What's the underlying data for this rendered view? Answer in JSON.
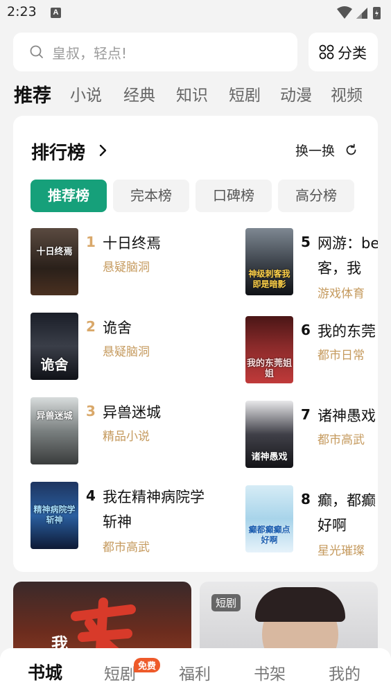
{
  "status": {
    "time": "2:23",
    "app_icon_letter": "A"
  },
  "search": {
    "placeholder": "皇叔，轻点!"
  },
  "category": {
    "label": "分类"
  },
  "tabs": [
    "推荐",
    "小说",
    "经典",
    "知识",
    "短剧",
    "动漫",
    "视频"
  ],
  "ranking": {
    "title": "排行榜",
    "refresh_label": "换一换",
    "subtabs": [
      "推荐榜",
      "完本榜",
      "口碑榜",
      "高分榜"
    ],
    "books": [
      {
        "rank": "1",
        "name": "十日终焉",
        "genre": "悬疑脑洞",
        "cover_text": "十日终焉"
      },
      {
        "rank": "2",
        "name": "诡舍",
        "genre": "悬疑脑洞",
        "cover_text": "诡舍"
      },
      {
        "rank": "3",
        "name": "异兽迷城",
        "genre": "精品小说",
        "cover_text": "异兽迷城"
      },
      {
        "rank": "4",
        "name_line1": "我在精神病院学",
        "name_line2": "斩神",
        "genre": "都市高武",
        "cover_text": "精神病院学斩神"
      },
      {
        "rank": "5",
        "name_line1": "网游：being",
        "name_line2": "客，我",
        "genre": "游戏体育",
        "cover_text": "神级刺客我即是暗影"
      },
      {
        "rank": "6",
        "name": "我的东莞",
        "genre": "都市日常",
        "cover_text": "我的东莞姐姐"
      },
      {
        "rank": "7",
        "name": "诸神愚戏",
        "genre": "都市高武",
        "cover_text": "诸神愚戏"
      },
      {
        "rank": "8",
        "name_line1": "癫，都癫",
        "name_line2": "好啊",
        "genre": "星光璀璨",
        "cover_text": "癫都癫癫点好啊"
      }
    ]
  },
  "features": {
    "right_badge": "短剧",
    "left_big_text": "我"
  },
  "bottom_nav": {
    "items": [
      "书城",
      "短剧",
      "福利",
      "书架",
      "我的"
    ],
    "free_badge": "免费"
  },
  "colors": {
    "accent": "#16a07a",
    "genre": "#c59a5e",
    "badge": "#ee5a2a"
  }
}
